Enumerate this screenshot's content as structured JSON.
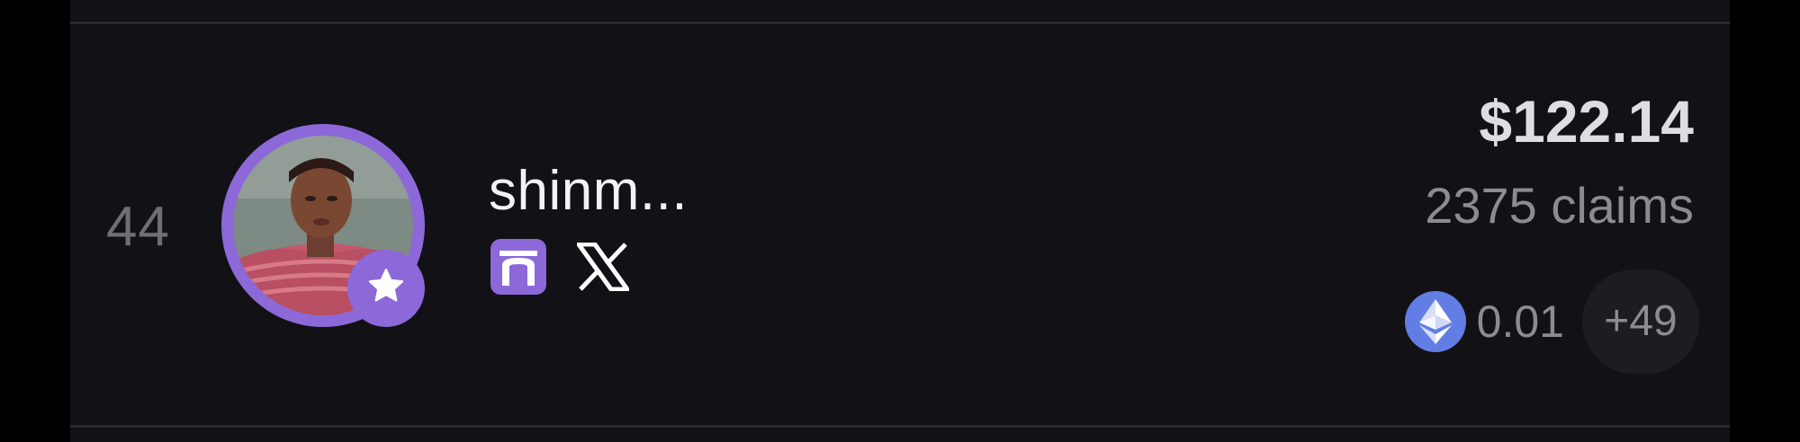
{
  "leaderboard_row": {
    "rank": "44",
    "user": {
      "name": "shinm...",
      "avatar_icon": "profile-photo",
      "badge_icon": "star-icon",
      "socials": [
        {
          "name": "portal-icon",
          "color": "#8c68d8"
        },
        {
          "name": "x-icon",
          "color": "#ffffff"
        }
      ]
    },
    "stats": {
      "amount": "$122.14",
      "claims": "2375 claims",
      "token": {
        "icon": "ethereum-icon",
        "amount": "0.01"
      },
      "more_tokens": "+49"
    }
  },
  "colors": {
    "background": "#121115",
    "accent": "#8c68d8",
    "ethereum": "#627ee4",
    "muted_text": "#8c8b92",
    "primary_text": "#f3f2f5"
  }
}
